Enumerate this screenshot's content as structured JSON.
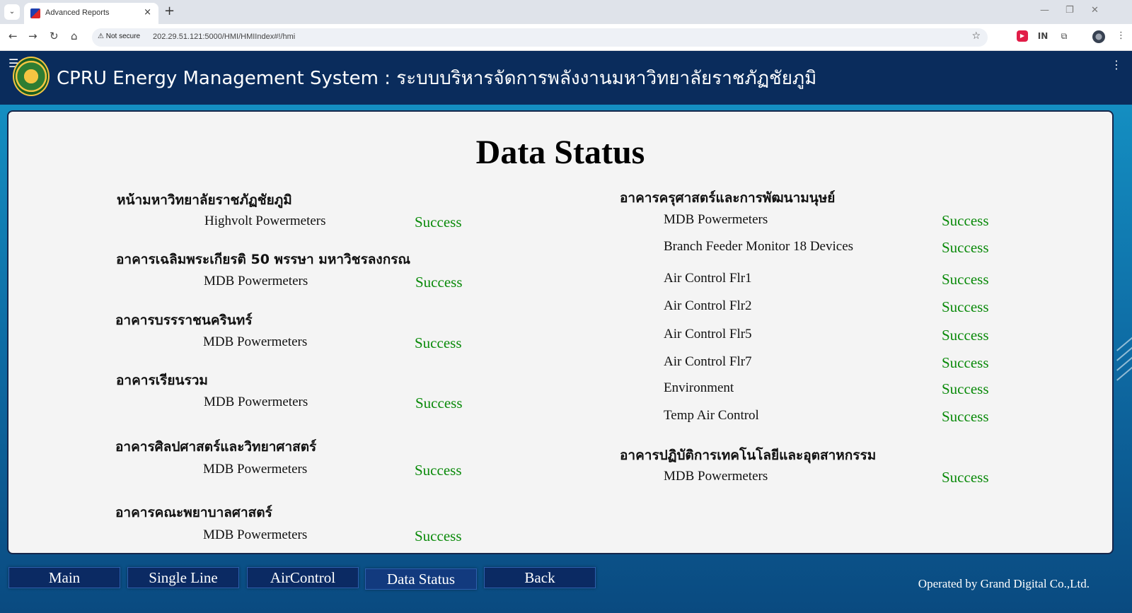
{
  "browser": {
    "tab_title": "Advanced Reports",
    "security_label": "Not secure",
    "url": "202.29.51.121:5000/HMI/HMIIndex#!/hmi",
    "new_tab": "+",
    "tab_close": "×"
  },
  "header": {
    "title": "CPRU Energy Management System : ระบบบริหารจัดการพลังงานมหาวิทยาลัยราชภัฏชัยภูมิ"
  },
  "page": {
    "title": "Data Status"
  },
  "left_column": [
    {
      "building": "หน้ามหาวิทยาลัยราชภัฏชัยภูมิ",
      "devices": [
        {
          "name": "Highvolt Powermeters",
          "status": "Success"
        }
      ]
    },
    {
      "building": "อาคารเฉลิมพระเกียรติ 50 พรรษา มหาวิชรลงกรณ",
      "devices": [
        {
          "name": "MDB Powermeters",
          "status": "Success"
        }
      ]
    },
    {
      "building": "อาคารบรรราชนครินทร์",
      "devices": [
        {
          "name": "MDB Powermeters",
          "status": "Success"
        }
      ]
    },
    {
      "building": "อาคารเรียนรวม",
      "devices": [
        {
          "name": "MDB Powermeters",
          "status": "Success"
        }
      ]
    },
    {
      "building": "อาคารศิลปศาสตร์และวิทยาศาสตร์",
      "devices": [
        {
          "name": "MDB Powermeters",
          "status": "Success"
        }
      ]
    },
    {
      "building": "อาคารคณะพยาบาลศาสตร์",
      "devices": [
        {
          "name": "MDB Powermeters",
          "status": "Success"
        }
      ]
    }
  ],
  "right_column": [
    {
      "building": "อาคารครุศาสตร์และการพัฒนามนุษย์",
      "devices": [
        {
          "name": "MDB Powermeters",
          "status": "Success"
        },
        {
          "name": "Branch Feeder Monitor 18 Devices",
          "status": "Success"
        },
        {
          "name": "Air Control Flr1",
          "status": "Success"
        },
        {
          "name": "Air Control Flr2",
          "status": "Success"
        },
        {
          "name": "Air Control Flr5",
          "status": "Success"
        },
        {
          "name": "Air Control Flr7",
          "status": "Success"
        },
        {
          "name": "Environment",
          "status": "Success"
        },
        {
          "name": "Temp Air Control",
          "status": "Success"
        }
      ]
    },
    {
      "building": "อาคารปฏิบัติการเทคโนโลยีและอุตสาหกรรม",
      "devices": [
        {
          "name": "MDB Powermeters",
          "status": "Success"
        }
      ]
    }
  ],
  "nav": {
    "main": "Main",
    "single_line": "Single Line",
    "air_control": "AirControl",
    "data_status": "Data Status",
    "back": "Back"
  },
  "footer": {
    "operator": "Operated by Grand Digital Co.,Ltd."
  },
  "colors": {
    "header_bg": "#0a2c5c",
    "status_success": "#0a8a0a",
    "panel_bg": "#f4f4f4",
    "nav_button_bg": "#0b2a63"
  },
  "icons": [
    "tab-list-icon",
    "favicon-icon",
    "close-icon",
    "plus-icon",
    "back-arrow-icon",
    "forward-arrow-icon",
    "reload-icon",
    "home-icon",
    "warning-icon",
    "star-icon",
    "extension-icon",
    "profile-icon",
    "menu-dots-icon",
    "hamburger-icon",
    "university-logo-icon"
  ]
}
